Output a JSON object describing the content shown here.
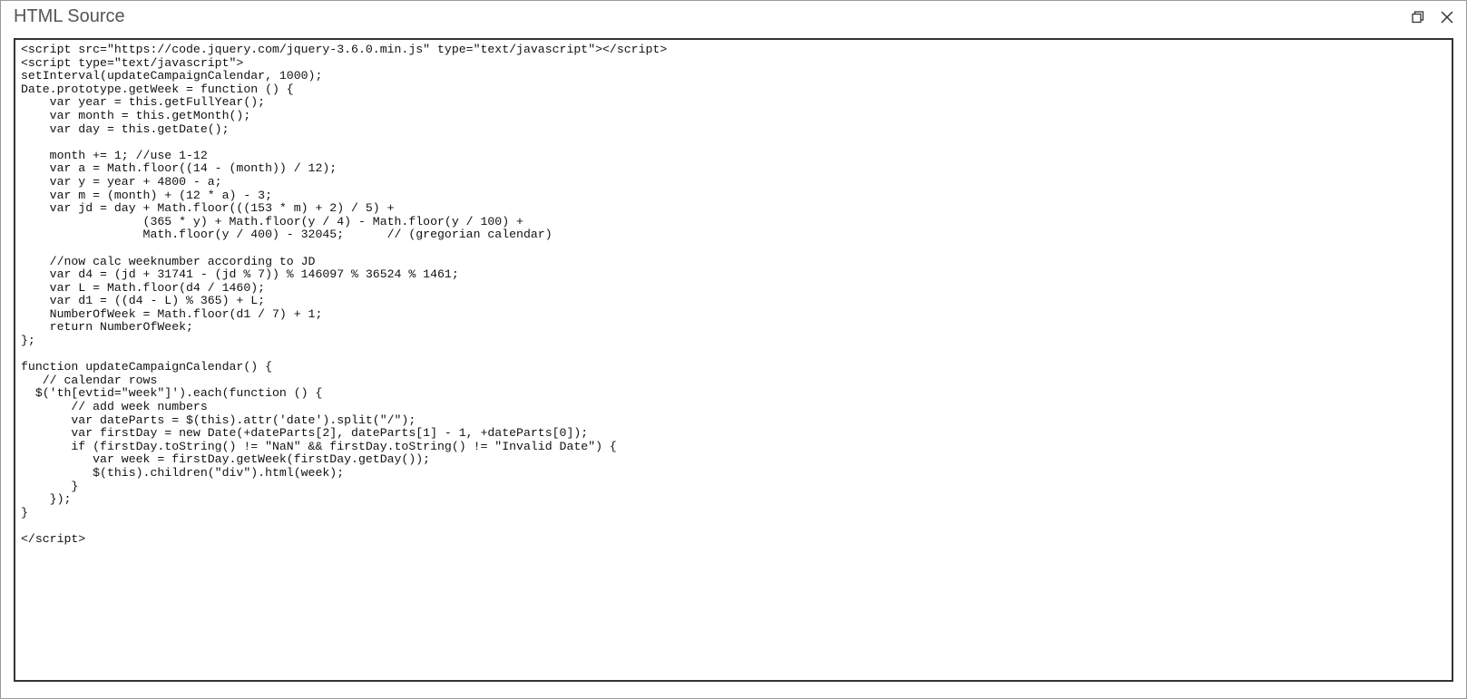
{
  "dialog": {
    "title": "HTML Source"
  },
  "editor": {
    "content": "<script src=\"https://code.jquery.com/jquery-3.6.0.min.js\" type=\"text/javascript\"></script>\n<script type=\"text/javascript\">\nsetInterval(updateCampaignCalendar, 1000);\nDate.prototype.getWeek = function () {\n    var year = this.getFullYear();\n    var month = this.getMonth();\n    var day = this.getDate();\n\n    month += 1; //use 1-12\n    var a = Math.floor((14 - (month)) / 12);\n    var y = year + 4800 - a;\n    var m = (month) + (12 * a) - 3;\n    var jd = day + Math.floor(((153 * m) + 2) / 5) +\n                 (365 * y) + Math.floor(y / 4) - Math.floor(y / 100) +\n                 Math.floor(y / 400) - 32045;      // (gregorian calendar)\n\n    //now calc weeknumber according to JD\n    var d4 = (jd + 31741 - (jd % 7)) % 146097 % 36524 % 1461;\n    var L = Math.floor(d4 / 1460);\n    var d1 = ((d4 - L) % 365) + L;\n    NumberOfWeek = Math.floor(d1 / 7) + 1;\n    return NumberOfWeek;\n};\n\nfunction updateCampaignCalendar() {\n   // calendar rows\n  $('th[evtid=\"week\"]').each(function () {\n       // add week numbers\n       var dateParts = $(this).attr('date').split(\"/\");\n       var firstDay = new Date(+dateParts[2], dateParts[1] - 1, +dateParts[0]);\n       if (firstDay.toString() != \"NaN\" && firstDay.toString() != \"Invalid Date\") {\n          var week = firstDay.getWeek(firstDay.getDay());\n          $(this).children(\"div\").html(week);\n       }\n    });\n}\n\n</script>"
  },
  "icons": {
    "maximize": "maximize-icon",
    "close": "close-icon"
  }
}
